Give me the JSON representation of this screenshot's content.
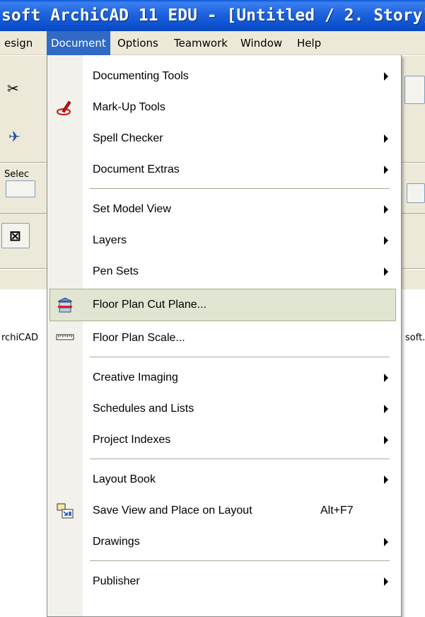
{
  "window": {
    "title": "soft ArchiCAD 11 EDU - [Untitled / 2. Story]"
  },
  "menubar": {
    "items": [
      {
        "label": "esign",
        "active": false
      },
      {
        "label": "Document",
        "active": true
      },
      {
        "label": "Options",
        "active": false
      },
      {
        "label": "Teamwork",
        "active": false
      },
      {
        "label": "Window",
        "active": false
      },
      {
        "label": "Help",
        "active": false
      }
    ]
  },
  "background": {
    "toolbox_label": "Selec",
    "left_status": "rchiCAD",
    "right_status": "soft."
  },
  "document_menu": {
    "items": [
      {
        "label": "Documenting Tools",
        "submenu": true,
        "icon": "none"
      },
      {
        "label": "Mark-Up Tools",
        "submenu": false,
        "icon": "markup-pen-icon"
      },
      {
        "label": "Spell Checker",
        "submenu": true,
        "icon": "none"
      },
      {
        "label": "Document Extras",
        "submenu": true,
        "icon": "none"
      },
      {
        "label": "Set Model View",
        "submenu": true,
        "icon": "none"
      },
      {
        "label": "Layers",
        "submenu": true,
        "icon": "none"
      },
      {
        "label": "Pen Sets",
        "submenu": true,
        "icon": "none"
      },
      {
        "label": "Floor Plan Cut Plane...",
        "submenu": false,
        "icon": "cut-plane-icon",
        "highlighted": true
      },
      {
        "label": "Floor Plan Scale...",
        "submenu": false,
        "icon": "ruler-icon"
      },
      {
        "label": "Creative Imaging",
        "submenu": true,
        "icon": "none"
      },
      {
        "label": "Schedules and Lists",
        "submenu": true,
        "icon": "none"
      },
      {
        "label": "Project Indexes",
        "submenu": true,
        "icon": "none"
      },
      {
        "label": "Layout Book",
        "submenu": true,
        "icon": "none"
      },
      {
        "label": "Save View and Place on Layout",
        "shortcut": "Alt+F7",
        "submenu": false,
        "icon": "place-on-layout-icon"
      },
      {
        "label": "Drawings",
        "submenu": true,
        "icon": "none"
      },
      {
        "label": "Publisher",
        "submenu": true,
        "icon": "none"
      }
    ]
  },
  "colors": {
    "titlebar": "#0a57d6",
    "menu_active": "#316ac5",
    "highlight": "#e0e6d1"
  }
}
